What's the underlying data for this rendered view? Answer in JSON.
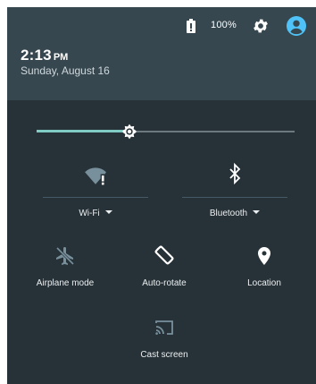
{
  "status_bar": {
    "battery_percent": "100%",
    "icons": [
      "battery-icon",
      "gear-icon",
      "account-icon"
    ]
  },
  "header": {
    "time": "2:13",
    "ampm": "PM",
    "date": "Sunday, August 16"
  },
  "brightness": {
    "level": 0.36
  },
  "tiles": {
    "wifi": {
      "label": "Wi-Fi",
      "icon": "wifi-no-internet-icon",
      "state": "off"
    },
    "bluetooth": {
      "label": "Bluetooth",
      "icon": "bluetooth-icon",
      "state": "on"
    },
    "airplane": {
      "label": "Airplane mode",
      "icon": "airplane-icon",
      "state": "off"
    },
    "autorotate": {
      "label": "Auto-rotate",
      "icon": "auto-rotate-icon",
      "state": "on"
    },
    "location": {
      "label": "Location",
      "icon": "location-pin-icon",
      "state": "on"
    },
    "cast": {
      "label": "Cast screen",
      "icon": "cast-icon",
      "state": "off"
    }
  },
  "colors": {
    "header_bg": "#37474f",
    "panel_bg": "#263238",
    "accent": "#80cbc4",
    "active_icon": "#ffffff",
    "inactive_icon": "#78909c",
    "avatar": "#4fc3f7"
  }
}
